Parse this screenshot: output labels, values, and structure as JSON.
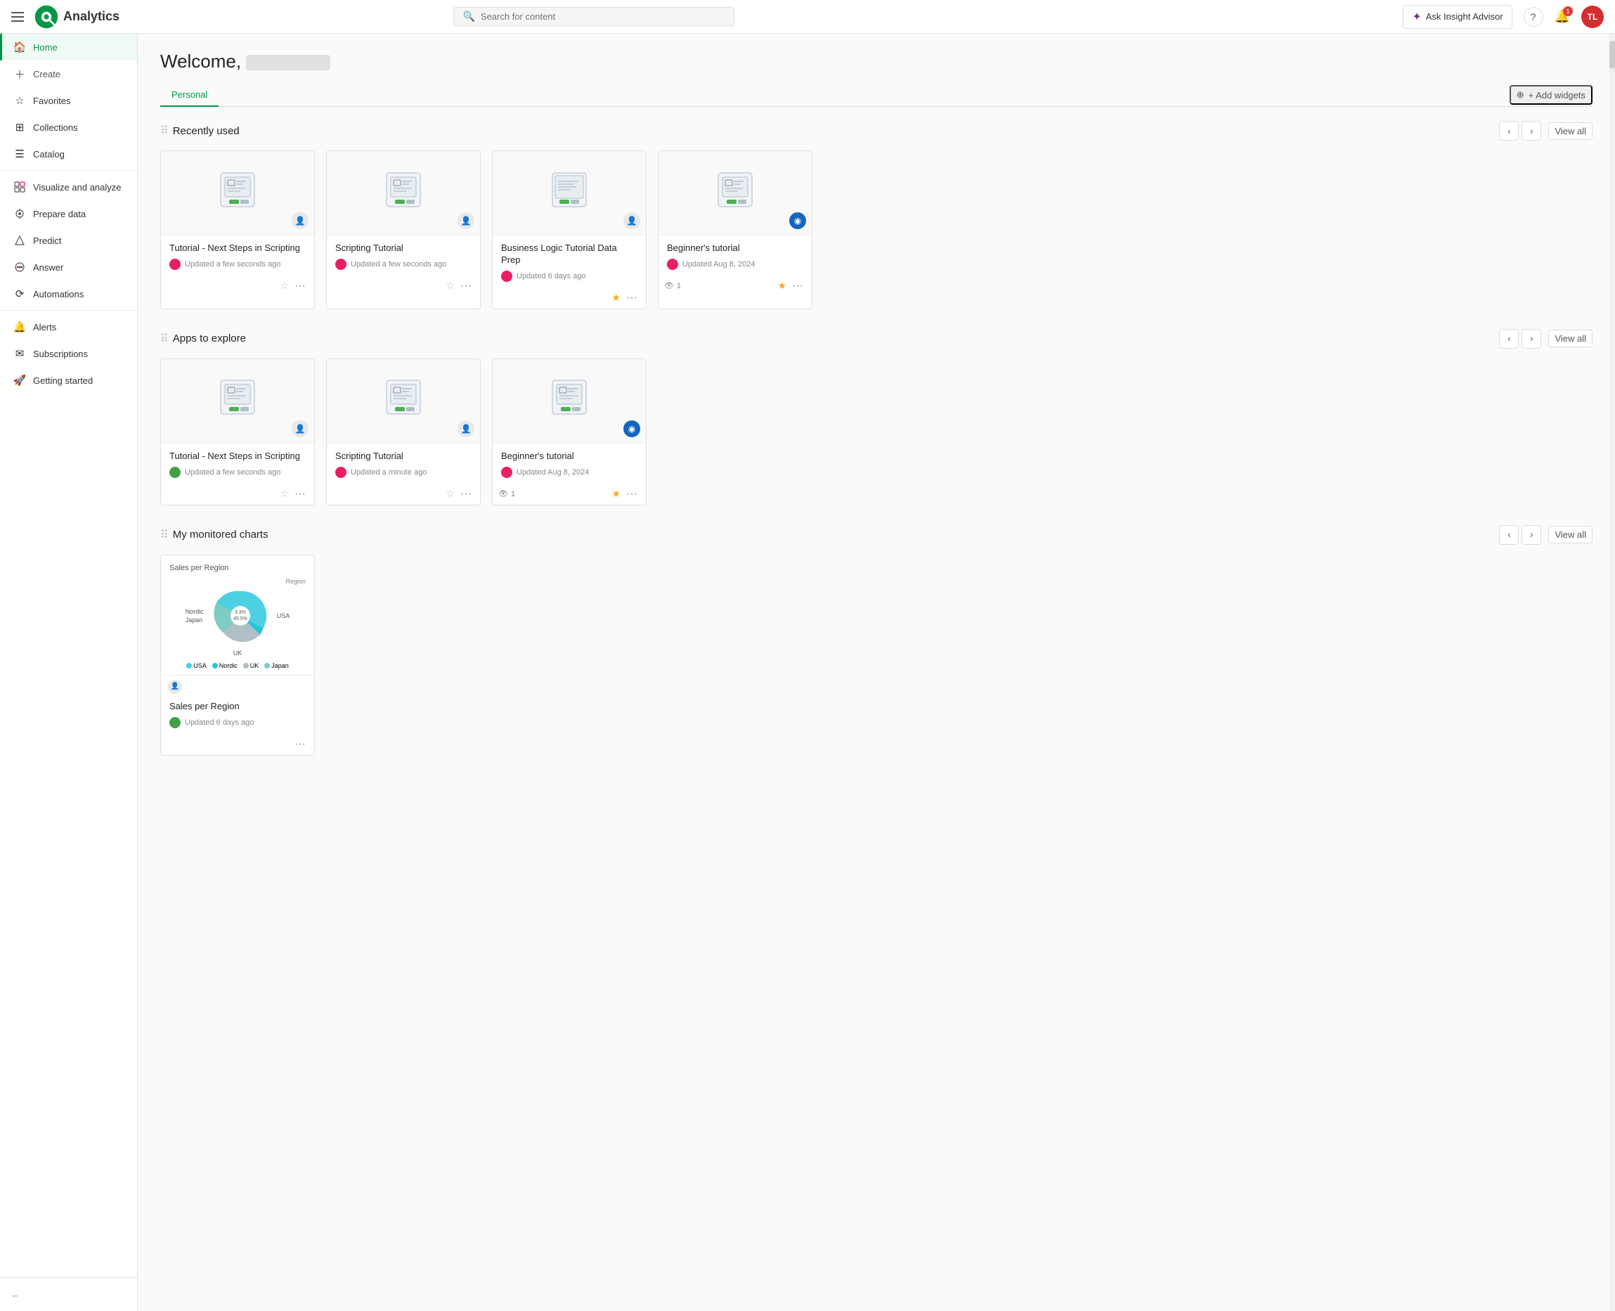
{
  "topnav": {
    "app_name": "Analytics",
    "search_placeholder": "Search for content",
    "insight_advisor_label": "Ask Insight Advisor",
    "notification_count": "1",
    "avatar_initials": "TL"
  },
  "sidebar": {
    "items": [
      {
        "id": "home",
        "label": "Home",
        "icon": "🏠",
        "active": true
      },
      {
        "id": "create",
        "label": "Create",
        "icon": "+",
        "is_create": true
      },
      {
        "id": "favorites",
        "label": "Favorites",
        "icon": "☆"
      },
      {
        "id": "collections",
        "label": "Collections",
        "icon": "⊞"
      },
      {
        "id": "catalog",
        "label": "Catalog",
        "icon": "⊟"
      },
      {
        "id": "visualize",
        "label": "Visualize and analyze",
        "icon": "◫"
      },
      {
        "id": "prepare",
        "label": "Prepare data",
        "icon": "◈"
      },
      {
        "id": "predict",
        "label": "Predict",
        "icon": "△"
      },
      {
        "id": "answer",
        "label": "Answer",
        "icon": "◉"
      },
      {
        "id": "automations",
        "label": "Automations",
        "icon": "⟳"
      },
      {
        "id": "alerts",
        "label": "Alerts",
        "icon": "🔔"
      },
      {
        "id": "subscriptions",
        "label": "Subscriptions",
        "icon": "✉"
      },
      {
        "id": "getting_started",
        "label": "Getting started",
        "icon": "🚀"
      }
    ],
    "collapse_label": "←"
  },
  "main": {
    "welcome_text": "Welcome,",
    "tabs": [
      {
        "id": "personal",
        "label": "Personal",
        "active": true
      }
    ],
    "add_widgets_label": "+ Add widgets",
    "sections": {
      "recently_used": {
        "title": "Recently used",
        "view_all": "View all",
        "cards": [
          {
            "id": 1,
            "title": "Tutorial - Next Steps in Scripting",
            "meta": "Updated a few seconds ago",
            "avatar_color": "pink",
            "badge_type": "user",
            "starred": false
          },
          {
            "id": 2,
            "title": "Scripting Tutorial",
            "meta": "Updated a few seconds ago",
            "avatar_color": "pink",
            "badge_type": "user",
            "starred": false
          },
          {
            "id": 3,
            "title": "Business Logic Tutorial Data Prep",
            "meta": "Updated 6 days ago",
            "avatar_color": "pink",
            "badge_type": "user",
            "starred": true
          },
          {
            "id": 4,
            "title": "Beginner's tutorial",
            "meta": "Updated Aug 8, 2024",
            "avatar_color": "pink",
            "badge_type": "blue",
            "starred": true
          }
        ],
        "views_count": "1"
      },
      "apps_to_explore": {
        "title": "Apps to explore",
        "view_all": "View all",
        "cards": [
          {
            "id": 1,
            "title": "Tutorial - Next Steps in Scripting",
            "meta": "Updated a few seconds ago",
            "avatar_color": "green",
            "badge_type": "user",
            "starred": false
          },
          {
            "id": 2,
            "title": "Scripting Tutorial",
            "meta": "Updated a minute ago",
            "avatar_color": "pink",
            "badge_type": "user",
            "starred": false
          },
          {
            "id": 3,
            "title": "Beginner's tutorial",
            "meta": "Updated Aug 8, 2024",
            "avatar_color": "pink",
            "badge_type": "blue",
            "starred": true
          }
        ],
        "views_count": "1"
      },
      "monitored_charts": {
        "title": "My monitored charts",
        "view_all": "View all",
        "cards": [
          {
            "id": 1,
            "title": "Sales per Region",
            "meta": "Updated 6 days ago",
            "avatar_color": "green",
            "badge_type": "user",
            "chart_title": "Sales per Region",
            "chart_type": "pie",
            "chart_legend_title": "Region",
            "pie_segments": [
              {
                "label": "USA",
                "value": 45.5,
                "color": "#4dd0e1"
              },
              {
                "label": "Nordic",
                "value": 3.3,
                "color": "#26c6da"
              },
              {
                "label": "Japan",
                "value": 12.3,
                "color": "#80cbc4"
              },
              {
                "label": "UK",
                "value": 26.9,
                "color": "#b0bec5"
              }
            ]
          }
        ]
      }
    }
  }
}
